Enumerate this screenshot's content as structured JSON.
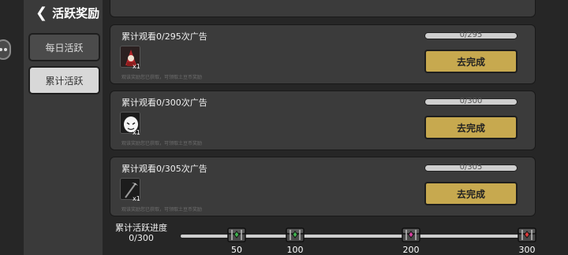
{
  "header": {
    "title": "活跃奖励",
    "back_icon": "chevron-left-icon"
  },
  "tabs": [
    {
      "label": "每日活跃",
      "selected": false
    },
    {
      "label": "累计活跃",
      "selected": true
    }
  ],
  "tasks": [
    {
      "title": "累计观看0/295次广告",
      "progress_text": "0/295",
      "progress": 0,
      "button": "去完成",
      "reward_count": "x1",
      "reward_icon": "red-hood-character-icon",
      "desc": "观该奖励您已获取，可领取土豆币奖励"
    },
    {
      "title": "累计观看0/300次广告",
      "progress_text": "0/300",
      "progress": 0,
      "button": "去完成",
      "reward_count": "x1",
      "reward_icon": "white-egg-character-icon",
      "desc": "观该奖励您已获取，可领取土豆币奖励"
    },
    {
      "title": "累计观看0/305次广告",
      "progress_text": "0/305",
      "progress": 0,
      "button": "去完成",
      "reward_count": "x1",
      "reward_icon": "pickaxe-weapon-icon",
      "desc": "观该奖励您已获取，可领取土豆币奖励"
    }
  ],
  "activity": {
    "label": "累计活跃进度",
    "value_text": "0/300",
    "progress": 0,
    "milestones": [
      {
        "label": "50",
        "chest_icon": "green-gem-chest-icon",
        "gem_color": "#3fb34f"
      },
      {
        "label": "100",
        "chest_icon": "green-gem-chest-icon",
        "gem_color": "#3fb34f"
      },
      {
        "label": "200",
        "chest_icon": "pink-gem-chest-icon",
        "gem_color": "#d83fa0"
      },
      {
        "label": "300",
        "chest_icon": "red-gem-chest-icon",
        "gem_color": "#e03a3a"
      }
    ]
  },
  "colors": {
    "button": "#c7a94f",
    "panel": "#3b3b3b",
    "background": "#262626"
  }
}
